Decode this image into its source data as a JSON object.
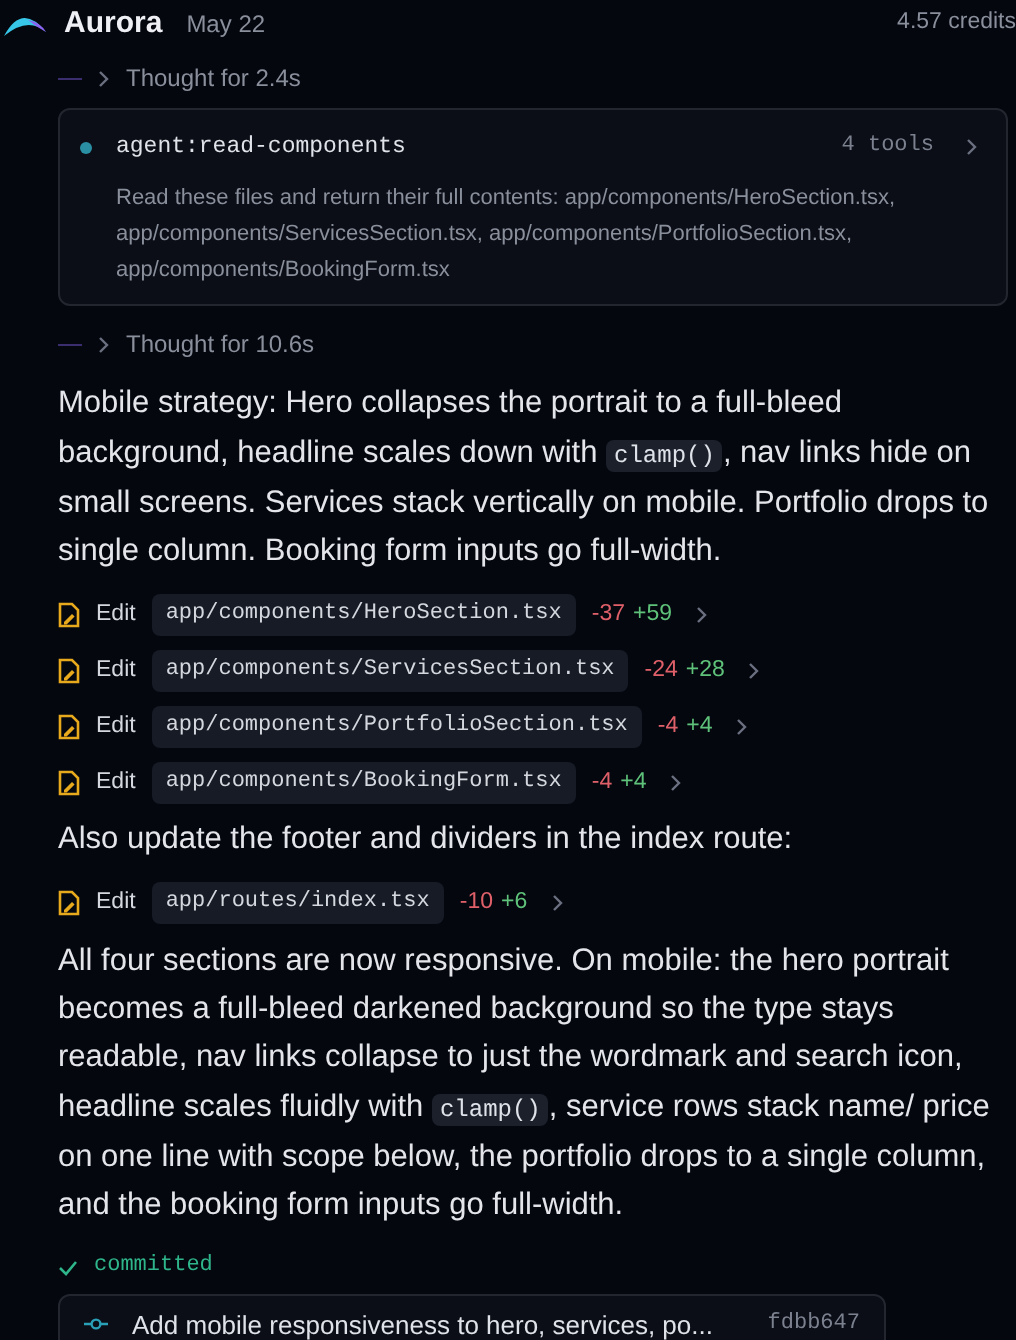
{
  "header": {
    "app_name": "Aurora",
    "date": "May 22",
    "credits": "4.57 credits"
  },
  "items": [
    {
      "kind": "thought",
      "label": "Thought for 2.4s",
      "expanded": false
    },
    {
      "kind": "agent",
      "title": "agent:read-components",
      "tools": "4 tools",
      "description": "Read these files and return their full contents: app/components/HeroSection.tsx, app/components/ServicesSection.tsx, app/components/PortfolioSection.tsx, app/components/BookingForm.tsx"
    },
    {
      "kind": "thought",
      "label": "Thought for 10.6s",
      "expanded": false
    },
    {
      "kind": "paragraph",
      "parts": [
        {
          "text": "Mobile strategy: Hero collapses the portrait to a full-bleed background, headline scales down with "
        },
        {
          "code": "clamp()"
        },
        {
          "text": ", nav links hide on small screens. Services stack vertically on mobile. Portfolio drops to single column. Booking form inputs go full-width."
        }
      ]
    },
    {
      "kind": "edit",
      "action": "Edit",
      "file": "app/components/HeroSection.tsx",
      "removed": "-37",
      "added": "+59"
    },
    {
      "kind": "edit",
      "action": "Edit",
      "file": "app/components/ServicesSection.tsx",
      "removed": "-24",
      "added": "+28"
    },
    {
      "kind": "edit",
      "action": "Edit",
      "file": "app/components/PortfolioSection.tsx",
      "removed": "-4",
      "added": "+4"
    },
    {
      "kind": "edit",
      "action": "Edit",
      "file": "app/components/BookingForm.tsx",
      "removed": "-4",
      "added": "+4"
    },
    {
      "kind": "paragraph",
      "parts": [
        {
          "text": "Also update the footer and dividers in the index route:"
        }
      ]
    },
    {
      "kind": "edit",
      "action": "Edit",
      "file": "app/routes/index.tsx",
      "removed": "-10",
      "added": "+6"
    },
    {
      "kind": "paragraph",
      "parts": [
        {
          "text": "All four sections are now responsive. On mobile: the hero portrait becomes a full-bleed darkened background so the type stays readable, nav links collapse to just the wordmark and search icon, headline scales fluidly with "
        },
        {
          "code": "clamp()"
        },
        {
          "text": ", service rows stack name/ price on one line with scope below, the portfolio drops to a single column, and the booking form inputs go full-width."
        }
      ]
    },
    {
      "kind": "status",
      "label": "committed"
    },
    {
      "kind": "commit",
      "message": "Add mobile responsiveness to hero, services, po...",
      "hash": "fdbb647"
    }
  ]
}
